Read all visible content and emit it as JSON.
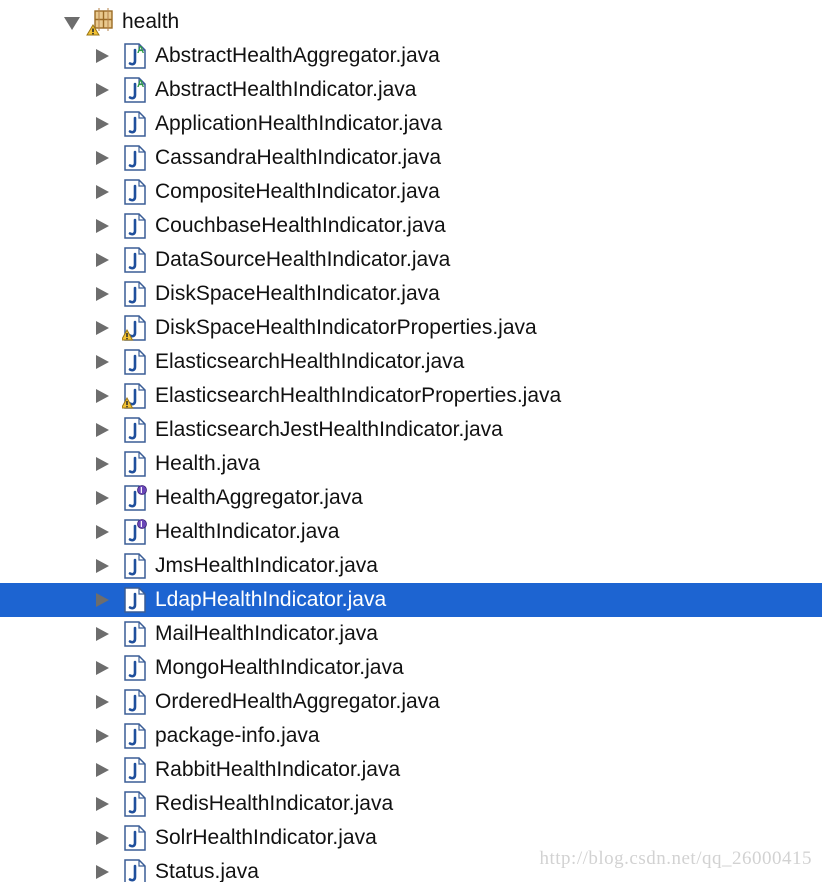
{
  "package": {
    "name": "health",
    "expanded": true,
    "badge": "warning"
  },
  "files": [
    {
      "name": "AbstractHealthAggregator.java",
      "kind": "abstract",
      "badge": null,
      "selected": false
    },
    {
      "name": "AbstractHealthIndicator.java",
      "kind": "abstract",
      "badge": null,
      "selected": false
    },
    {
      "name": "ApplicationHealthIndicator.java",
      "kind": "class",
      "badge": null,
      "selected": false
    },
    {
      "name": "CassandraHealthIndicator.java",
      "kind": "class",
      "badge": null,
      "selected": false
    },
    {
      "name": "CompositeHealthIndicator.java",
      "kind": "class",
      "badge": null,
      "selected": false
    },
    {
      "name": "CouchbaseHealthIndicator.java",
      "kind": "class",
      "badge": null,
      "selected": false
    },
    {
      "name": "DataSourceHealthIndicator.java",
      "kind": "class",
      "badge": null,
      "selected": false
    },
    {
      "name": "DiskSpaceHealthIndicator.java",
      "kind": "class",
      "badge": null,
      "selected": false
    },
    {
      "name": "DiskSpaceHealthIndicatorProperties.java",
      "kind": "class",
      "badge": "warning",
      "selected": false
    },
    {
      "name": "ElasticsearchHealthIndicator.java",
      "kind": "class",
      "badge": null,
      "selected": false
    },
    {
      "name": "ElasticsearchHealthIndicatorProperties.java",
      "kind": "class",
      "badge": "warning",
      "selected": false
    },
    {
      "name": "ElasticsearchJestHealthIndicator.java",
      "kind": "class",
      "badge": null,
      "selected": false
    },
    {
      "name": "Health.java",
      "kind": "class",
      "badge": null,
      "selected": false
    },
    {
      "name": "HealthAggregator.java",
      "kind": "interface",
      "badge": null,
      "selected": false
    },
    {
      "name": "HealthIndicator.java",
      "kind": "interface",
      "badge": null,
      "selected": false
    },
    {
      "name": "JmsHealthIndicator.java",
      "kind": "class",
      "badge": null,
      "selected": false
    },
    {
      "name": "LdapHealthIndicator.java",
      "kind": "class",
      "badge": null,
      "selected": true
    },
    {
      "name": "MailHealthIndicator.java",
      "kind": "class",
      "badge": null,
      "selected": false
    },
    {
      "name": "MongoHealthIndicator.java",
      "kind": "class",
      "badge": null,
      "selected": false
    },
    {
      "name": "OrderedHealthAggregator.java",
      "kind": "class",
      "badge": null,
      "selected": false
    },
    {
      "name": "package-info.java",
      "kind": "class",
      "badge": null,
      "selected": false
    },
    {
      "name": "RabbitHealthIndicator.java",
      "kind": "class",
      "badge": null,
      "selected": false
    },
    {
      "name": "RedisHealthIndicator.java",
      "kind": "class",
      "badge": null,
      "selected": false
    },
    {
      "name": "SolrHealthIndicator.java",
      "kind": "class",
      "badge": null,
      "selected": false
    },
    {
      "name": "Status.java",
      "kind": "class",
      "badge": null,
      "selected": false
    }
  ],
  "watermark": "http://blog.csdn.net/qq_26000415",
  "icons": {
    "expand": "chevron-right-icon",
    "collapse": "chevron-down-icon",
    "package": "package-icon",
    "class": "java-file-icon",
    "abstract": "java-abstract-file-icon",
    "interface": "java-interface-file-icon",
    "warning": "warning-icon"
  },
  "colors": {
    "selection": "#1d64d1",
    "selection_text": "#ffffff",
    "text": "#111111",
    "arrow": "#6d6d6d",
    "file_border": "#2a4f8c",
    "abstract_letter": "#2d9a46",
    "interface_badge": "#6a46b8",
    "warning": "#f3c335",
    "package_main": "#c99a4a"
  }
}
